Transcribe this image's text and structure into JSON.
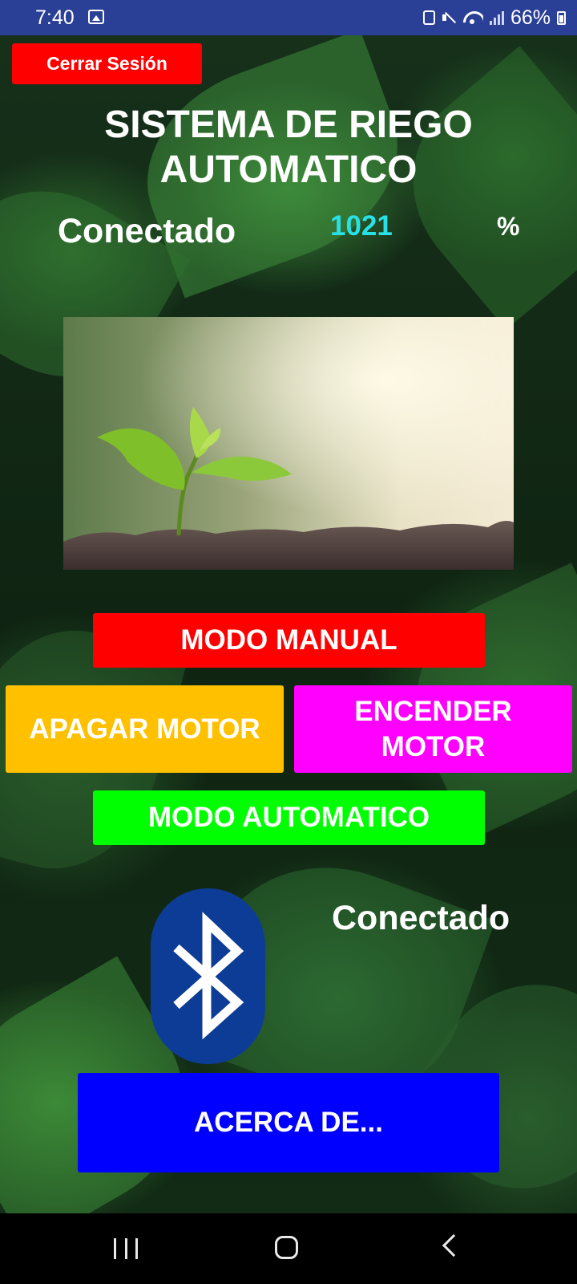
{
  "status_bar": {
    "time": "7:40",
    "battery": "66%",
    "icons": [
      "image-icon",
      "sync-icon",
      "mute-icon",
      "wifi-icon",
      "signal-icon",
      "battery-icon"
    ]
  },
  "header": {
    "logout_label": "Cerrar Sesión",
    "title_line1": "SISTEMA DE RIEGO",
    "title_line2": "AUTOMATICO"
  },
  "sensor": {
    "connection_status": "Conectado",
    "humidity_value": "1021",
    "humidity_unit": "%"
  },
  "controls": {
    "manual_mode_label": "MODO MANUAL",
    "motor_off_label": "APAGAR MOTOR",
    "motor_on_line1": "ENCENDER",
    "motor_on_line2": "MOTOR",
    "auto_mode_label": "MODO AUTOMATICO"
  },
  "bluetooth": {
    "icon": "bluetooth-icon",
    "status": "Conectado"
  },
  "footer": {
    "about_label": "ACERCA DE..."
  },
  "colors": {
    "status_bar": "#2a3f96",
    "logout": "#ff0000",
    "manual": "#ff0000",
    "motor_off": "#ffc000",
    "motor_on": "#ff00ff",
    "auto": "#00ff00",
    "about": "#0000ff",
    "humidity_value": "#27e1e6",
    "bluetooth": "#0d3c96"
  },
  "nav_bar": {
    "icons": [
      "recent-apps-icon",
      "home-icon",
      "back-icon"
    ]
  }
}
